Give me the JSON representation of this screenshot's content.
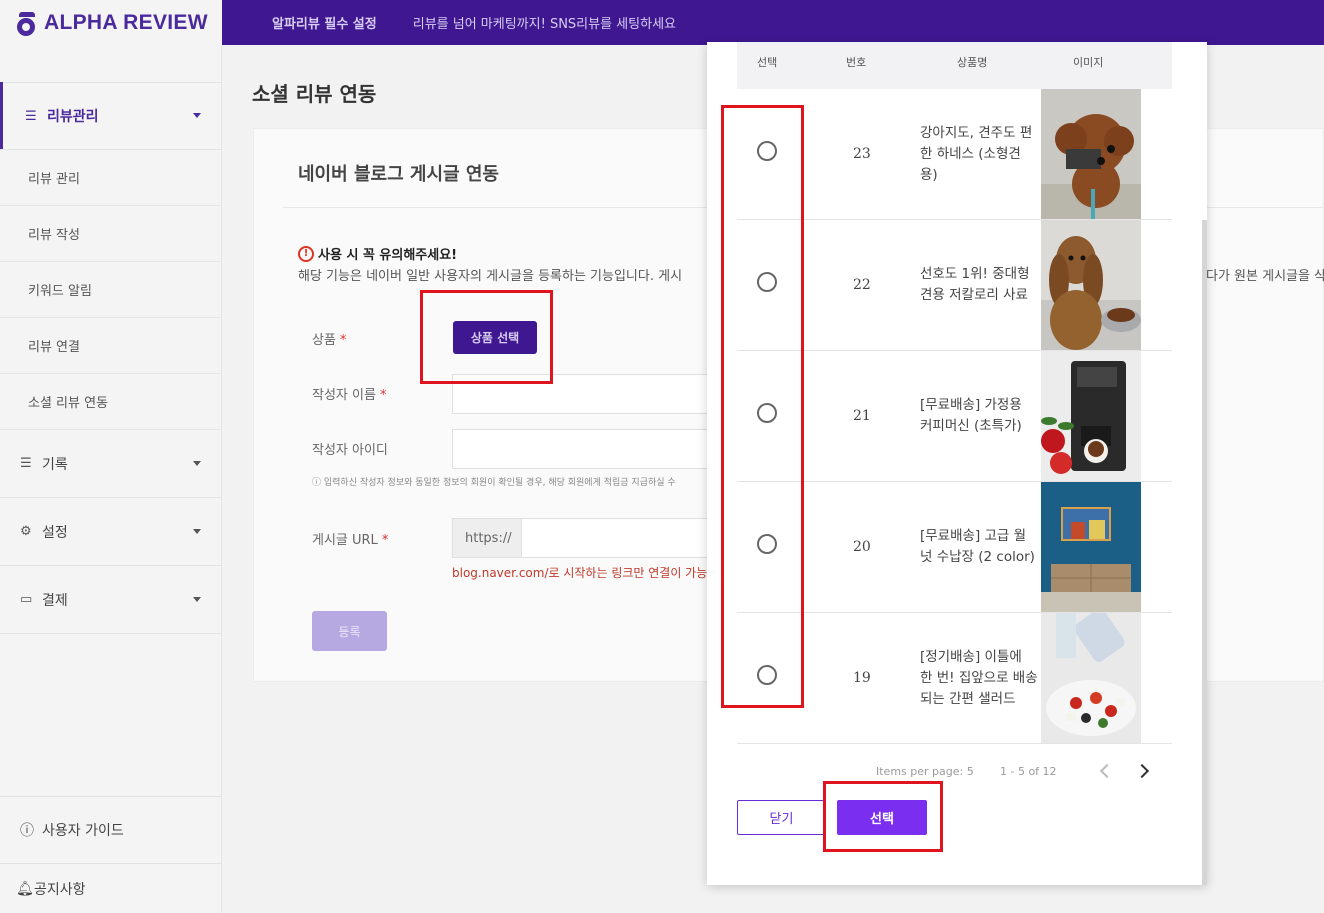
{
  "app": {
    "logo_text": "ALPHA REVIEW",
    "brand_color": "#3f1791",
    "accent_color": "#7a2ff0",
    "highlight_color": "#e0141e"
  },
  "topbar": {
    "item1": "알파리뷰 필수 설정",
    "item2": "리뷰를 넘어 마케팅까지! SNS리뷰를 세팅하세요"
  },
  "sidebar": {
    "groups": [
      {
        "label": "리뷰관리",
        "icon": "list-icon",
        "expanded": true
      },
      {
        "label": "기록",
        "icon": "list-icon"
      },
      {
        "label": "설정",
        "icon": "gear-icon"
      },
      {
        "label": "결제",
        "icon": "card-icon"
      }
    ],
    "sub_items": [
      "리뷰 관리",
      "리뷰 작성",
      "키워드 알림",
      "리뷰 연결",
      "소셜 리뷰 연동"
    ],
    "footer": [
      {
        "label": "사용자 가이드",
        "icon": "help-icon"
      },
      {
        "label": "공지사항",
        "icon": "bell-icon"
      }
    ]
  },
  "main": {
    "page_title": "소셜 리뷰 연동",
    "card_title": "네이버 블로그 게시글 연동",
    "warning_title": "사용 시 꼭 유의해주세요!",
    "warning_desc_left": "해당 기능은 네이버 일반 사용자의 게시글을 등록하는 기능입니다. 게시",
    "warning_desc_right": "다가 원본 게시글을 삭",
    "fields": {
      "product_label": "상품",
      "product_button": "상품 선택",
      "author_name_label": "작성자 이름",
      "author_id_label": "작성자 아이디",
      "note": "ⓘ 입력하신 작성자 정보와 동일한 정보의 회원이 확인될 경우, 해당 회원에게 적립금 지급하실 수",
      "url_label": "게시글 URL",
      "url_prefix": "https://",
      "url_hint": "blog.naver.com/로 시작하는 링크만 연결이 가능합",
      "required_mark": "*"
    },
    "register_button": "등록"
  },
  "modal": {
    "columns": [
      "선택",
      "번호",
      "상품명",
      "이미지"
    ],
    "rows": [
      {
        "no": "23",
        "name": "강아지도, 견주도 편한 하네스 (소형견용)",
        "image": "dog-poodle-photo"
      },
      {
        "no": "22",
        "name": "선호도 1위! 중대형견용 저칼로리 사료",
        "image": "dog-spaniel-photo"
      },
      {
        "no": "21",
        "name": "[무료배송] 가정용 커피머신 (초특가)",
        "image": "coffee-machine-photo"
      },
      {
        "no": "20",
        "name": "[무료배송] 고급 월넛 수납장 (2 color)",
        "image": "cabinet-photo"
      },
      {
        "no": "19",
        "name": "[정기배송] 이틀에 한 번! 집앞으로 배송되는 간편 샐러드",
        "image": "salad-photo"
      }
    ],
    "pagination": {
      "items_per_page": "Items per page: 5",
      "range": "1 - 5 of 12"
    },
    "close_button": "닫기",
    "select_button": "선택"
  }
}
